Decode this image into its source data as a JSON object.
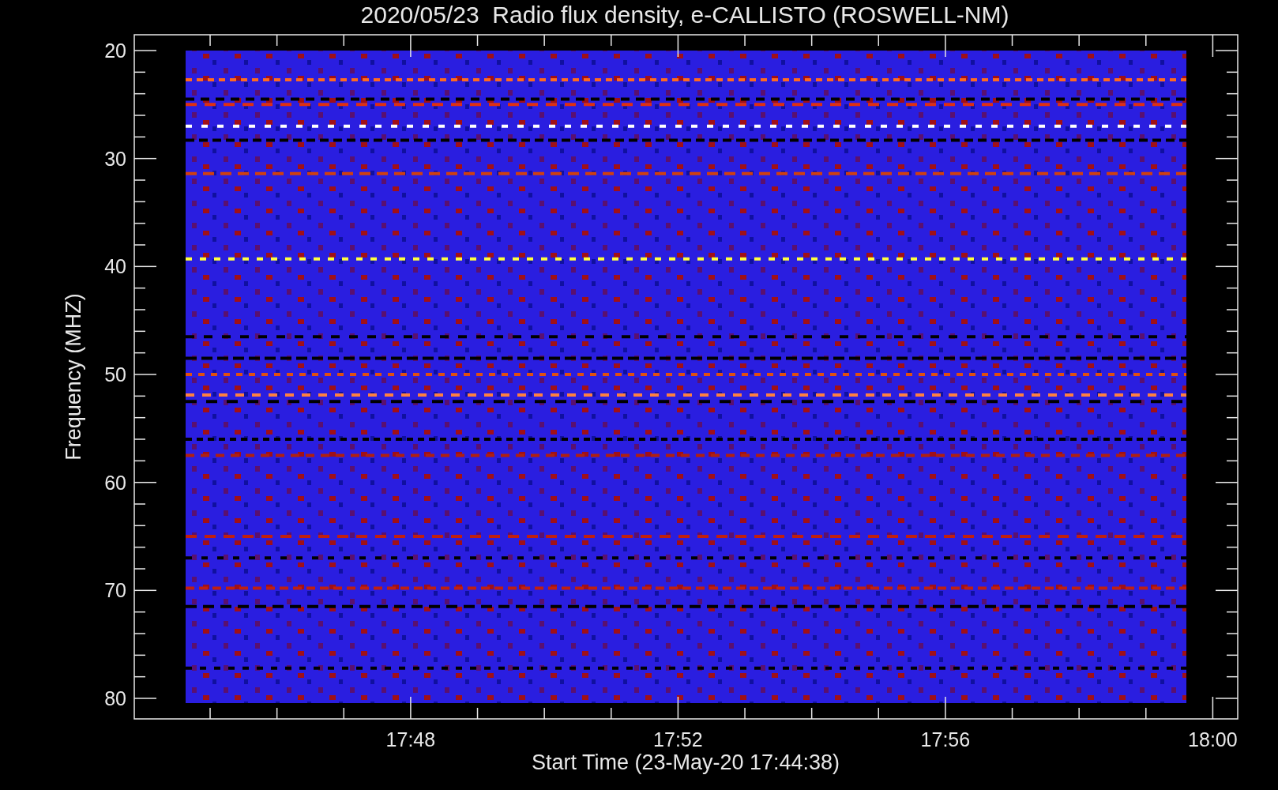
{
  "chart": {
    "title": "2020/05/23  Radio flux density, e-CALLISTO (ROSWELL-NM)",
    "y_axis": {
      "label": "Frequency (MHZ)",
      "ticks": [
        "20",
        "30",
        "40",
        "50",
        "60",
        "70",
        "80"
      ]
    },
    "x_axis": {
      "label": "Start Time (23-May-20 17:44:38)",
      "ticks": [
        "17:48",
        "17:52",
        "17:56",
        "18:00"
      ]
    }
  }
}
